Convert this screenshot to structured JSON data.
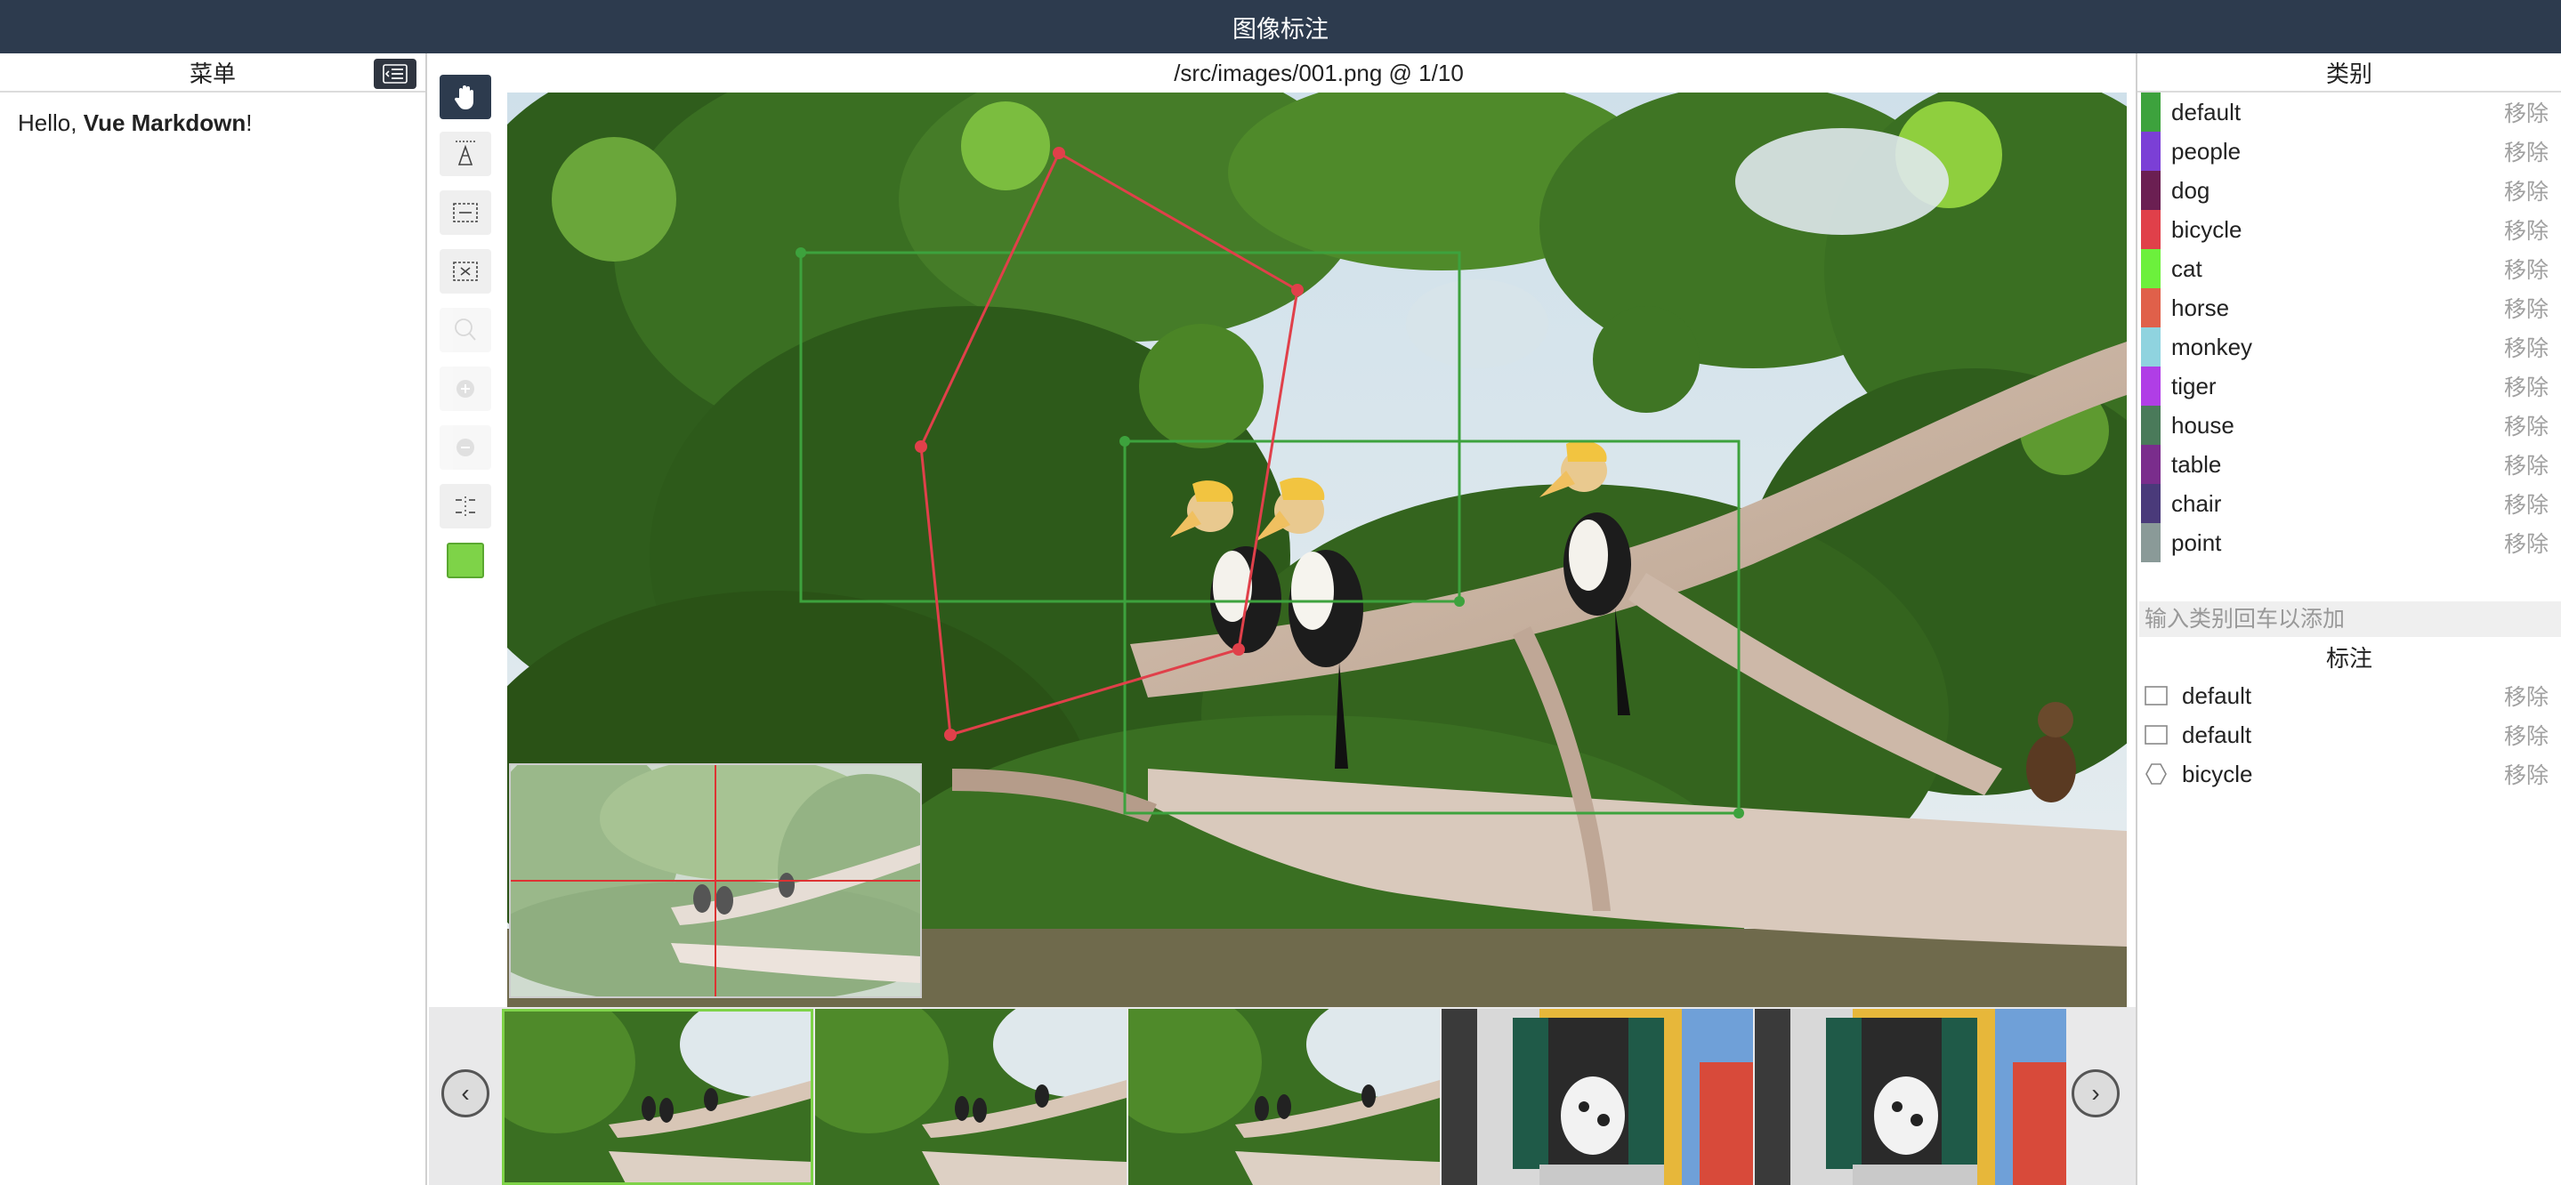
{
  "app": {
    "title": "图像标注"
  },
  "left": {
    "header": "菜单",
    "content_prefix": "Hello, ",
    "content_bold": "Vue Markdown",
    "content_suffix": "!"
  },
  "main": {
    "path": "/src/images/001.png @ 1/10"
  },
  "tools": [
    {
      "name": "hand-tool",
      "state": "active"
    },
    {
      "name": "polygon-tool",
      "state": "normal"
    },
    {
      "name": "rect-tool",
      "state": "normal"
    },
    {
      "name": "point-tool",
      "state": "normal"
    },
    {
      "name": "magic-tool",
      "state": "disabled"
    },
    {
      "name": "zoom-in-tool",
      "state": "disabled"
    },
    {
      "name": "zoom-out-tool",
      "state": "disabled"
    },
    {
      "name": "crosshair-tool",
      "state": "normal"
    }
  ],
  "current_color": "#7ed348",
  "categories": {
    "header": "类别",
    "remove_label": "移除",
    "items": [
      {
        "name": "default",
        "color": "#3da23d"
      },
      {
        "name": "people",
        "color": "#7b3fd6"
      },
      {
        "name": "dog",
        "color": "#6b1f52"
      },
      {
        "name": "bicycle",
        "color": "#e0404a"
      },
      {
        "name": "cat",
        "color": "#6cf03c"
      },
      {
        "name": "horse",
        "color": "#e0604a"
      },
      {
        "name": "monkey",
        "color": "#8fd3df"
      },
      {
        "name": "tiger",
        "color": "#b03ee6"
      },
      {
        "name": "house",
        "color": "#4a7a5a"
      },
      {
        "name": "table",
        "color": "#7a2d8c"
      },
      {
        "name": "chair",
        "color": "#4a3a7a"
      },
      {
        "name": "point",
        "color": "#8a9a98"
      }
    ],
    "input_placeholder": "输入类别回车以添加"
  },
  "annotations": {
    "header": "标注",
    "remove_label": "移除",
    "items": [
      {
        "name": "default",
        "shape": "rect"
      },
      {
        "name": "default",
        "shape": "rect"
      },
      {
        "name": "bicycle",
        "shape": "polygon"
      }
    ]
  },
  "filmstrip": {
    "thumbnails": [
      "hornbills",
      "hornbills",
      "hornbills",
      "dog-window",
      "dog-window"
    ],
    "prev_label": "‹",
    "next_label": "›"
  }
}
